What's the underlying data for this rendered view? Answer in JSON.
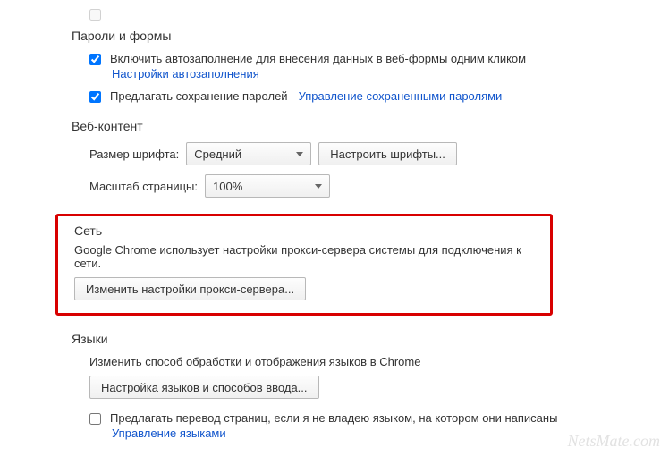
{
  "passwords_forms": {
    "title": "Пароли и формы",
    "autofill": {
      "label": "Включить автозаполнение для внесения данных в веб-формы одним кликом",
      "link": "Настройки автозаполнения",
      "checked": true
    },
    "save_passwords": {
      "label": "Предлагать сохранение паролей",
      "link": "Управление сохраненными паролями",
      "checked": true
    }
  },
  "web_content": {
    "title": "Веб-контент",
    "font_size_label": "Размер шрифта:",
    "font_size_value": "Средний",
    "customize_fonts_btn": "Настроить шрифты...",
    "zoom_label": "Масштаб страницы:",
    "zoom_value": "100%"
  },
  "network": {
    "title": "Сеть",
    "info": "Google Chrome использует настройки прокси-сервера системы для подключения к сети.",
    "change_proxy_btn": "Изменить настройки прокси-сервера..."
  },
  "languages": {
    "title": "Языки",
    "info": "Изменить способ обработки и отображения языков в Chrome",
    "lang_input_btn": "Настройка языков и способов ввода...",
    "translate": {
      "label": "Предлагать перевод страниц, если я не владею языком, на котором они написаны",
      "link": "Управление языками",
      "checked": false
    }
  },
  "watermark": "NetsMate.com"
}
